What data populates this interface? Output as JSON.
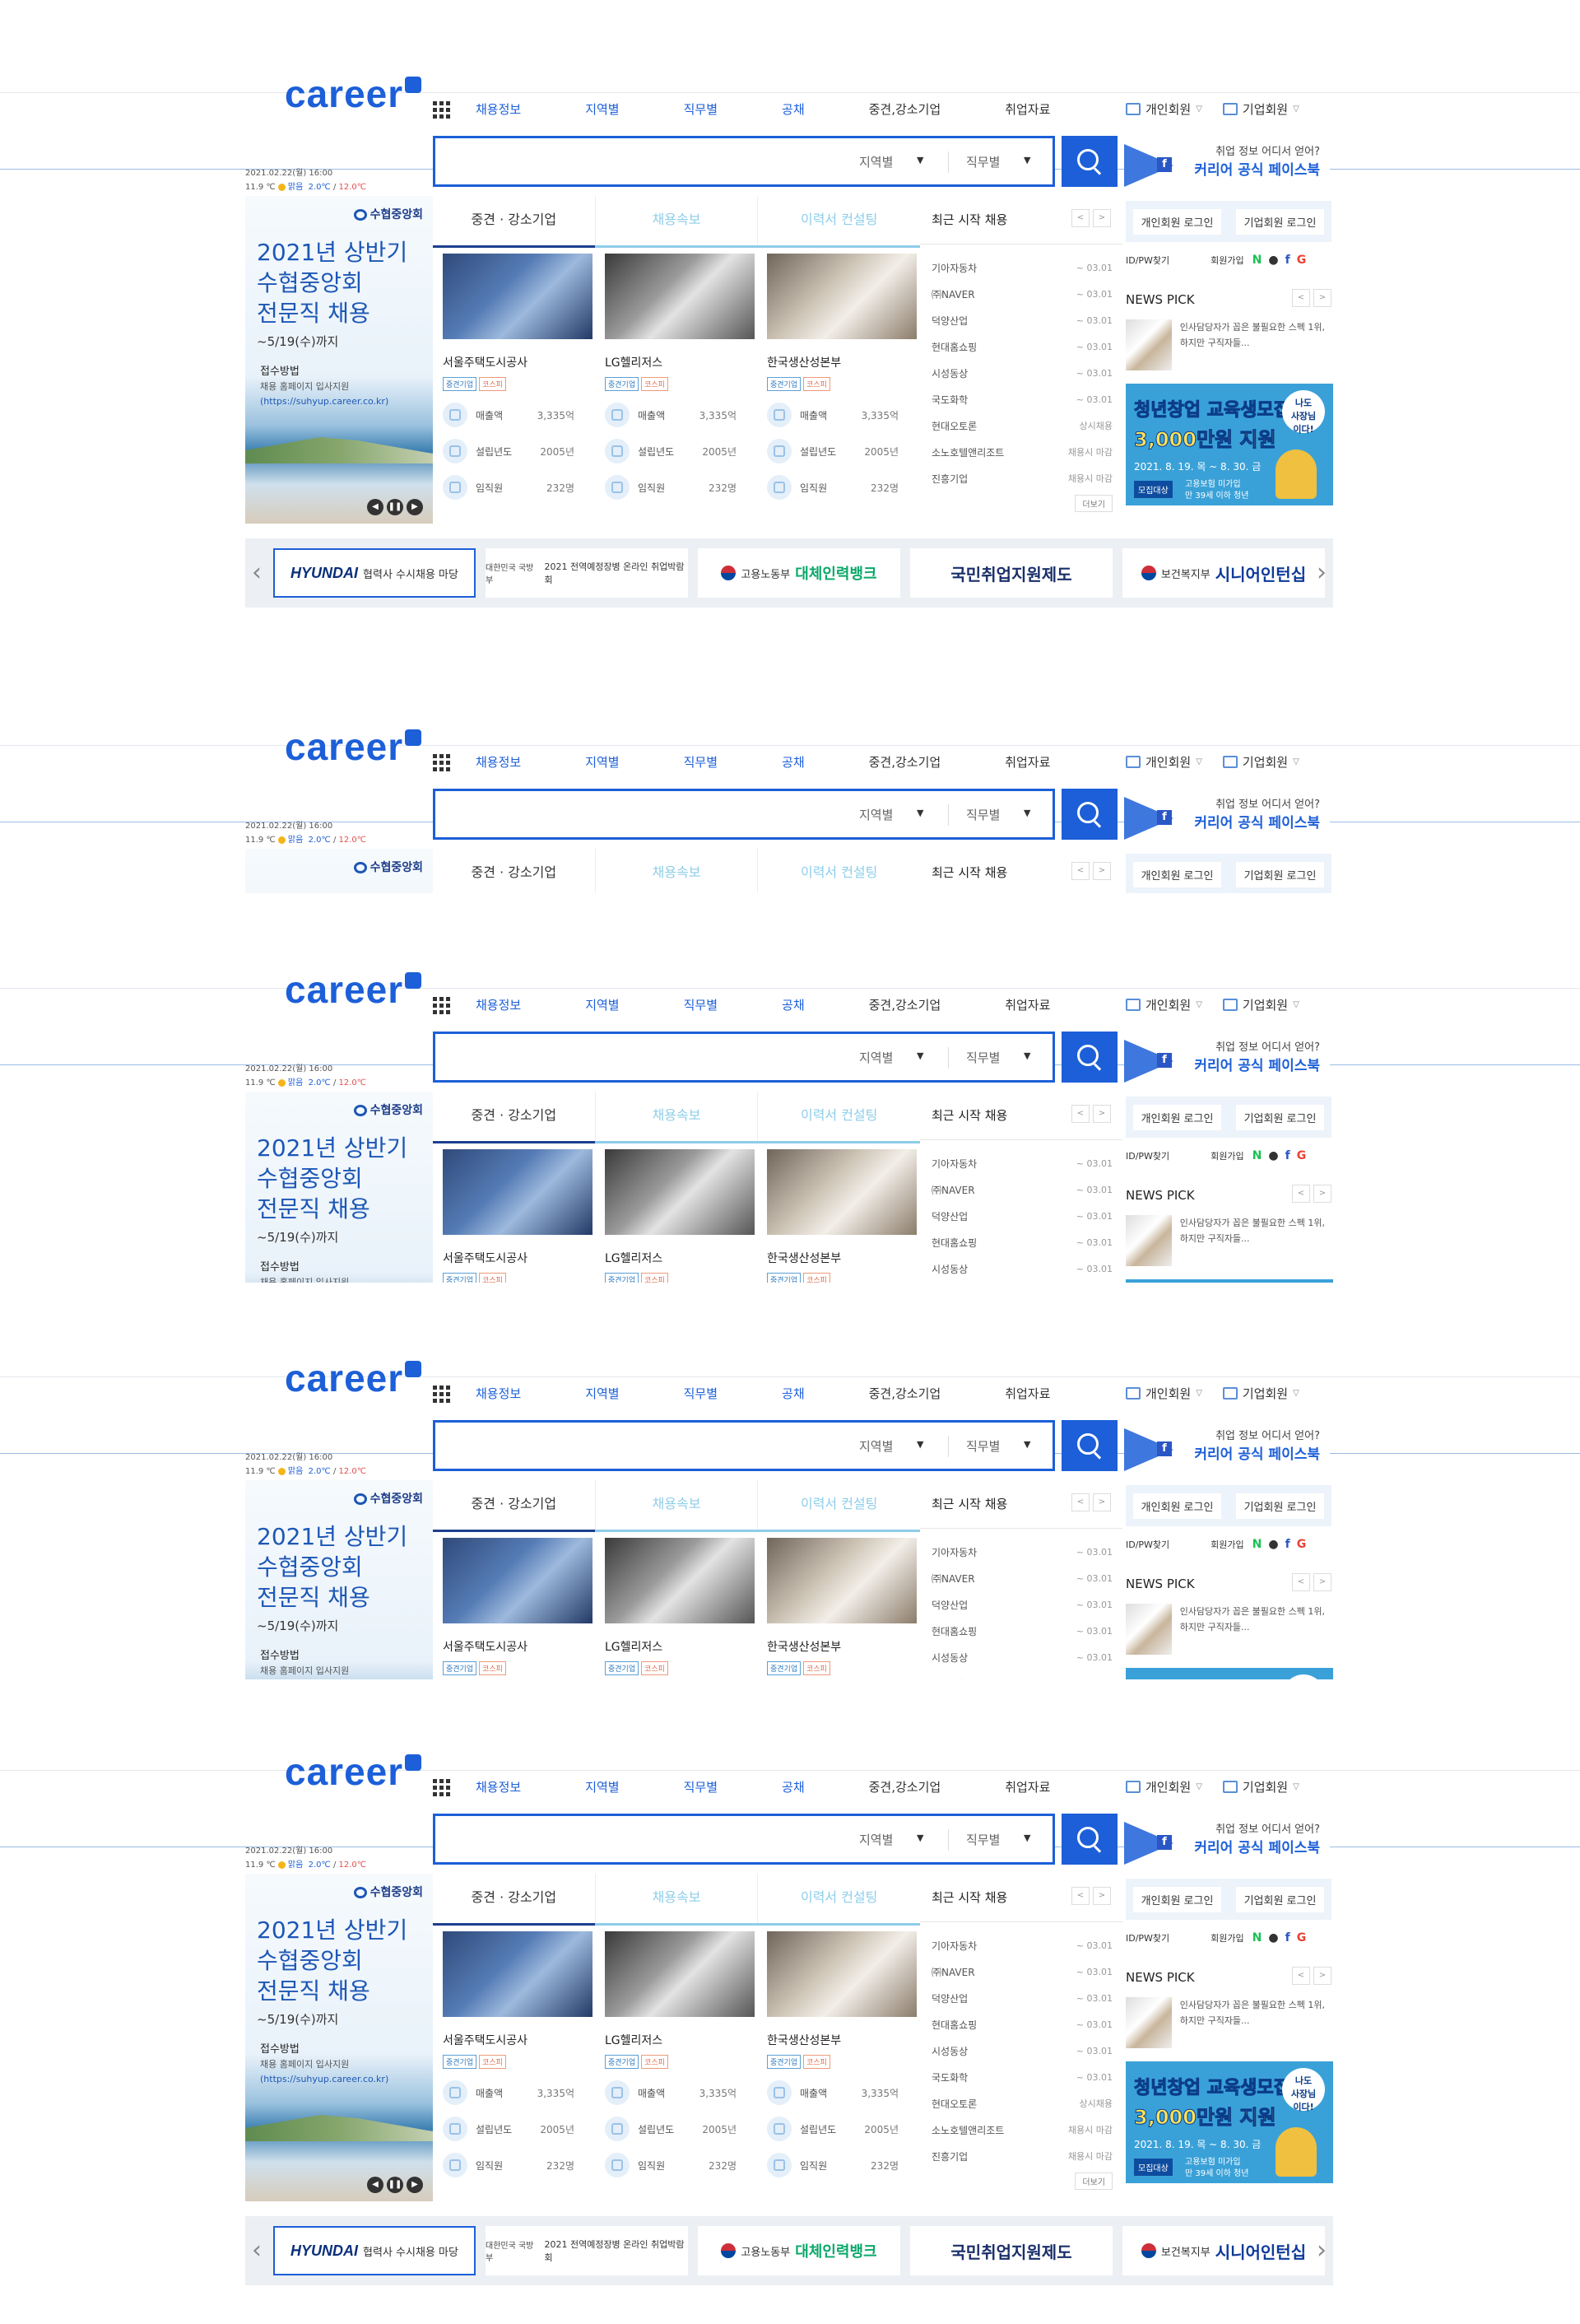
{
  "header": {
    "logo": "career",
    "nav": [
      "채용정보",
      "지역별",
      "직무별",
      "공채",
      "중견,강소기업",
      "취업자료"
    ],
    "member_personal": "개인회원",
    "member_company": "기업회원",
    "search_region": "지역별",
    "search_job": "직무별",
    "fb_line1": "취업 정보 어디서 얻어?",
    "fb_line2": "커리어 공식 페이스북",
    "fb_icon": "f"
  },
  "weather": {
    "datetime": "2021.02.22(월) 16:00",
    "temp": "11.9 ℃",
    "cond": "맑음",
    "low": "2.0℃",
    "sep": "/",
    "high": "12.0℃"
  },
  "left_ad": {
    "brand": "수협중앙회",
    "headline": "2021년 상반기\n수협중앙회\n전문직 채용",
    "until": "~5/19(수)까지",
    "apply": "접수방법",
    "apply_desc": "채용 홈페이지 입사지원",
    "apply_url": "(https://suhyup.career.co.kr)"
  },
  "tabs": [
    "중견 · 강소기업",
    "채용속보",
    "이력서 컨설팅"
  ],
  "companies": [
    {
      "name": "서울주택도시공사",
      "tags": [
        "중견기업",
        "코스피"
      ],
      "sales": "3,335억",
      "founded": "2005년",
      "staff": "232명"
    },
    {
      "name": "LG헬리저스",
      "tags": [
        "중견기업",
        "코스피"
      ],
      "sales": "3,335억",
      "founded": "2005년",
      "staff": "232명"
    },
    {
      "name": "한국생산성본부",
      "tags": [
        "중견기업",
        "코스피"
      ],
      "sales": "3,335억",
      "founded": "2005년",
      "staff": "232명"
    }
  ],
  "company_labels": {
    "sales": "매출액",
    "founded": "설립년도",
    "staff": "임직원"
  },
  "recent": {
    "title": "최근 시작 채용",
    "items": [
      {
        "name": "기아자동차",
        "date": "~ 03.01"
      },
      {
        "name": "㈜NAVER",
        "date": "~ 03.01"
      },
      {
        "name": "덕양산업",
        "date": "~ 03.01"
      },
      {
        "name": "현대홈쇼핑",
        "date": "~ 03.01"
      },
      {
        "name": "시성동상",
        "date": "~ 03.01"
      },
      {
        "name": "국도화학",
        "date": "~ 03.01"
      },
      {
        "name": "현대오토론",
        "date": "상시채용"
      },
      {
        "name": "소노호텔앤리조트",
        "date": "채용시 마감"
      },
      {
        "name": "진흥기업",
        "date": "채용시 마감"
      }
    ],
    "more": "더보기"
  },
  "right": {
    "login_personal": "개인회원 로그인",
    "login_company": "기업회원 로그인",
    "idpw": "ID/PW찾기",
    "signup": "회원가입",
    "news_title": "NEWS PICK",
    "news_text": "인사담당자가 꼽은 불필요한 스펙 1위, 하지만 구직자들...",
    "ad_line1": "청년창업 교육생모집",
    "ad_line2": "3,000만원 지원",
    "ad_date": "2021. 8. 19. 목 ~ 8. 30. 금",
    "ad_target": "모집대상",
    "ad_target_desc": "고용보험 미가입\n만 39세 이하 청년",
    "ad_bubble": "나도\n사장님\n이다!"
  },
  "banners": {
    "hyundai": "HYUNDAI",
    "hyundai_text": "협력사 수시채용 마당",
    "mnd_small": "대한민국 국방부",
    "mnd_text": "2021 전역예정장병 온라인 취업박람회",
    "moel": "고용노동부",
    "moel_text": "대체인력뱅크",
    "kuk": "국민취업지원제도",
    "mohw": "보건복지부",
    "mohw_text": "시니어인턴십"
  }
}
